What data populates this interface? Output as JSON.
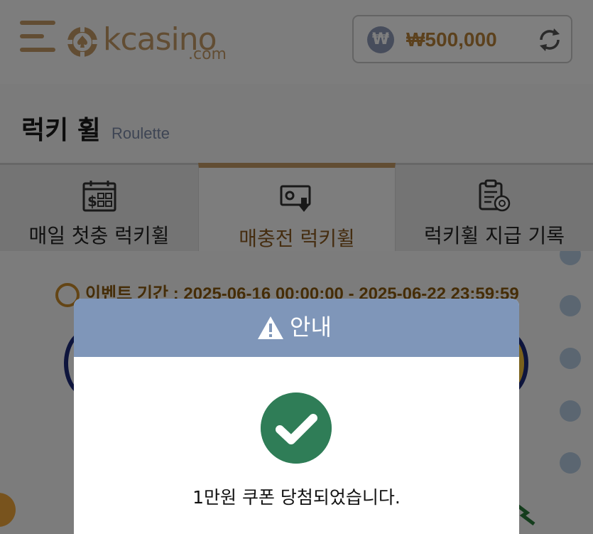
{
  "header": {
    "brand": "kcasino",
    "brand_suffix": ".com",
    "balance": {
      "currency_symbol": "₩",
      "amount": "₩500,000"
    }
  },
  "page": {
    "title": "럭키 휠",
    "subtitle": "Roulette"
  },
  "tabs": [
    {
      "label": "매일 첫충 럭키휠",
      "icon": "calendar-dollar-icon",
      "active": false
    },
    {
      "label": "매충전 럭키휠",
      "icon": "cash-deposit-icon",
      "active": true
    },
    {
      "label": "럭키휠 지급 기록",
      "icon": "clipboard-history-icon",
      "active": false
    }
  ],
  "event": {
    "period_text": "이벤트 기간 : 2025-06-16 00:00:00 - 2025-06-22 23:59:59"
  },
  "modal": {
    "title": "안내",
    "icon": "success-check-icon",
    "message": "1만원 쿠폰 당첨되었습니다."
  },
  "colors": {
    "accent_gold": "#c49b66",
    "modal_header": "#7f96b9",
    "success_green": "#2f7d57"
  }
}
